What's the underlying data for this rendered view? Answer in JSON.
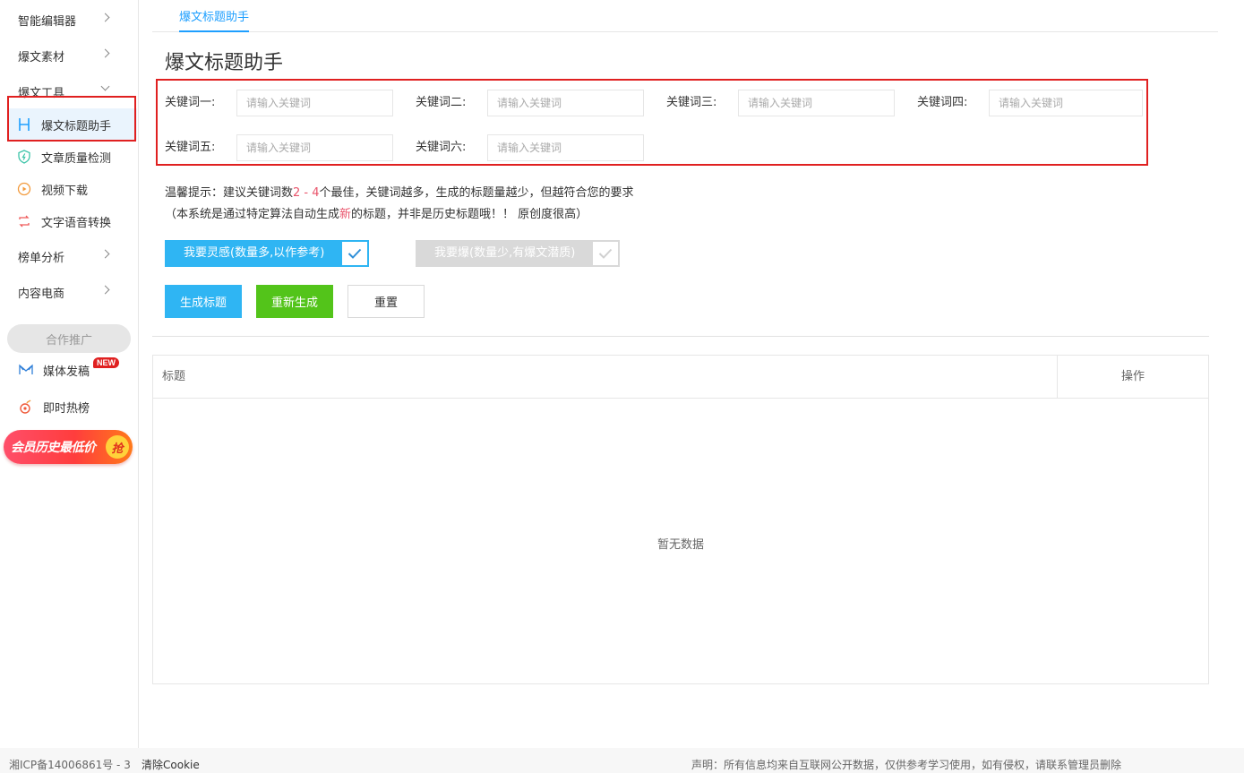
{
  "sidebar": {
    "groups": [
      {
        "label": "智能编辑器"
      },
      {
        "label": "爆文素材"
      },
      {
        "label": "爆文工具"
      },
      {
        "label": "榜单分析"
      },
      {
        "label": "内容电商"
      }
    ],
    "tools": [
      {
        "label": "爆文标题助手",
        "icon": "h-letter-icon",
        "active": true
      },
      {
        "label": "文章质量检测",
        "icon": "shield-bolt-icon"
      },
      {
        "label": "视频下载",
        "icon": "video-download-icon"
      },
      {
        "label": "文字语音转换",
        "icon": "convert-arrows-icon"
      }
    ],
    "promo_label": "合作推广",
    "promo_items": [
      {
        "label": "媒体发稿",
        "icon": "media-icon",
        "badge": "NEW"
      },
      {
        "label": "即时热榜",
        "icon": "flame-icon"
      }
    ],
    "vip_banner": {
      "text": "会员历史最低价",
      "grab": "抢"
    }
  },
  "tabs": [
    {
      "label": "爆文标题助手"
    }
  ],
  "page_title": "爆文标题助手",
  "keywords": [
    {
      "label": "关键词一:",
      "placeholder": "请输入关键词",
      "value": ""
    },
    {
      "label": "关键词二:",
      "placeholder": "请输入关键词",
      "value": ""
    },
    {
      "label": "关键词三:",
      "placeholder": "请输入关键词",
      "value": ""
    },
    {
      "label": "关键词四:",
      "placeholder": "请输入关键词",
      "value": ""
    },
    {
      "label": "关键词五:",
      "placeholder": "请输入关键词",
      "value": ""
    },
    {
      "label": "关键词六:",
      "placeholder": "请输入关键词",
      "value": ""
    }
  ],
  "tip": {
    "line1_a": "温馨提示：建议关键词数",
    "line1_range": "2 - 4",
    "line1_b": "个最佳，关键词越多，生成的标题量越少，但越符合您的要求",
    "line2_a": "（本系统是通过特定算法自动生成",
    "line2_new": "新",
    "line2_b": "的标题，并非是历史标题哦！！ 原创度很高）"
  },
  "modes": [
    {
      "label": "我要灵感(数量多,以作参考)",
      "checked": true
    },
    {
      "label": "我要爆(数量少,有爆文潜质)",
      "checked": false
    }
  ],
  "buttons": {
    "generate": "生成标题",
    "regenerate": "重新生成",
    "reset": "重置"
  },
  "table": {
    "col_title": "标题",
    "col_action": "操作",
    "empty_text": "暂无数据"
  },
  "footer": {
    "icp": "湘ICP备14006861号 - 3",
    "cookie": "清除Cookie",
    "statement": "声明：所有信息均来自互联网公开数据，仅供参考学习使用，如有侵权，请联系管理员删除"
  },
  "colors": {
    "primary": "#2fb5f3",
    "green": "#53c41a",
    "highlight": "#e02020",
    "accent_red": "#e9546b",
    "tab_blue": "#1e9fff"
  }
}
